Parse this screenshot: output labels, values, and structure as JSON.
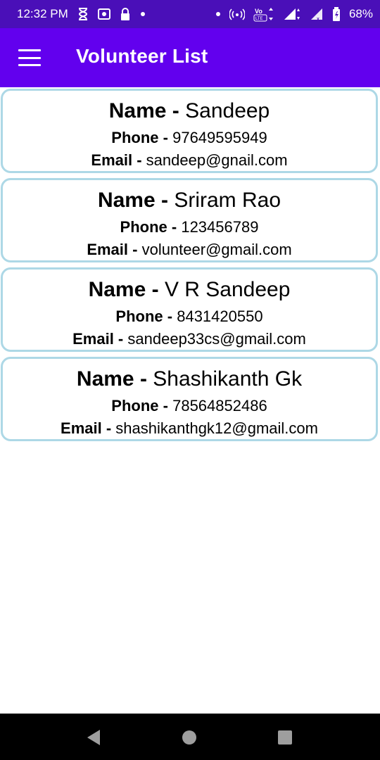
{
  "status_bar": {
    "time": "12:32 PM",
    "battery": "68%",
    "network_label": "VoLTE",
    "icons_left": [
      "hourglass-icon",
      "screenshot-icon",
      "lock-icon",
      "dot-icon"
    ],
    "icons_right": [
      "dot-icon",
      "hotspot-icon",
      "volte-icon",
      "signal-icon",
      "signal-icon",
      "battery-icon"
    ]
  },
  "app_bar": {
    "title": "Volunteer List",
    "menu_icon": "menu-icon"
  },
  "labels": {
    "name": "Name -",
    "phone": "Phone -",
    "email": "Email -"
  },
  "volunteers": [
    {
      "name": "Sandeep",
      "phone": "97649595949",
      "email": "sandeep@gnail.com"
    },
    {
      "name": "Sriram Rao",
      "phone": "123456789",
      "email": "volunteer@gmail.com"
    },
    {
      "name": "V R Sandeep",
      "phone": "8431420550",
      "email": "sandeep33cs@gmail.com"
    },
    {
      "name": "Shashikanth Gk",
      "phone": "78564852486",
      "email": "shashikanthgk12@gmail.com"
    }
  ],
  "colors": {
    "status_bar": "#4a0fb8",
    "app_bar": "#6200ee",
    "card_border": "#add8e6",
    "nav_bar": "#000000"
  },
  "nav_bar": {
    "icons": [
      "back-icon",
      "home-icon",
      "recents-icon"
    ]
  }
}
